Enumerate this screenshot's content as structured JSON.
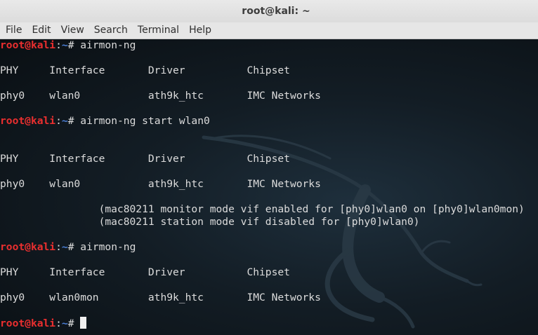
{
  "window": {
    "title": "root@kali: ~"
  },
  "menu": [
    "File",
    "Edit",
    "View",
    "Search",
    "Terminal",
    "Help"
  ],
  "prompt": {
    "user": "root",
    "at": "@",
    "host": "kali",
    "sep": ":",
    "path": "~",
    "symbol": "# "
  },
  "lines": [
    {
      "type": "prompt",
      "command": "airmon-ng"
    },
    {
      "type": "blank"
    },
    {
      "type": "text",
      "text": "PHY\tInterface\tDriver\t\tChipset"
    },
    {
      "type": "blank"
    },
    {
      "type": "text",
      "text": "phy0\twlan0\t\tath9k_htc\tIMC Networks"
    },
    {
      "type": "blank"
    },
    {
      "type": "prompt",
      "command": "airmon-ng start wlan0"
    },
    {
      "type": "blank"
    },
    {
      "type": "blank"
    },
    {
      "type": "text",
      "text": "PHY\tInterface\tDriver\t\tChipset"
    },
    {
      "type": "blank"
    },
    {
      "type": "text",
      "text": "phy0\twlan0\t\tath9k_htc\tIMC Networks"
    },
    {
      "type": "blank"
    },
    {
      "type": "text",
      "text": "\t\t(mac80211 monitor mode vif enabled for [phy0]wlan0 on [phy0]wlan0mon)"
    },
    {
      "type": "text",
      "text": "\t\t(mac80211 station mode vif disabled for [phy0]wlan0)"
    },
    {
      "type": "blank"
    },
    {
      "type": "prompt",
      "command": "airmon-ng"
    },
    {
      "type": "blank"
    },
    {
      "type": "text",
      "text": "PHY\tInterface\tDriver\t\tChipset"
    },
    {
      "type": "blank"
    },
    {
      "type": "text",
      "text": "phy0\twlan0mon\tath9k_htc\tIMC Networks"
    },
    {
      "type": "blank"
    },
    {
      "type": "prompt",
      "command": "",
      "cursor": true
    }
  ],
  "colors": {
    "prompt_user": "#ea2f2f",
    "prompt_path": "#4b7fd6",
    "foreground": "#dcdcdc",
    "background": "#0d1216",
    "titlebar": "#e6e6e6"
  },
  "icons": {
    "background": "kali-dragon-logo"
  }
}
